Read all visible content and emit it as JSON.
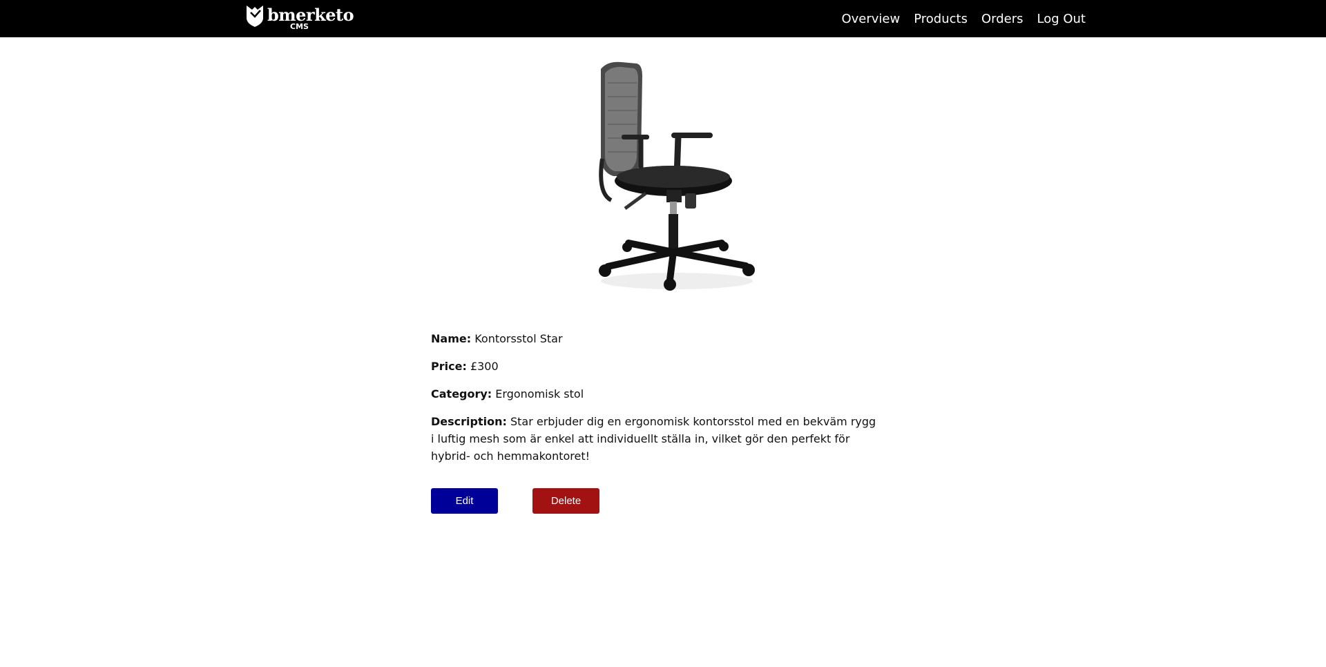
{
  "header": {
    "brand_name": "bmerketo",
    "brand_sub": "CMS",
    "nav": [
      {
        "label": "Overview"
      },
      {
        "label": "Products"
      },
      {
        "label": "Orders"
      },
      {
        "label": "Log Out"
      }
    ]
  },
  "product": {
    "name_label": "Name:",
    "name": "Kontorsstol Star",
    "price_label": "Price:",
    "price": "£300",
    "category_label": "Category:",
    "category": "Ergonomisk stol",
    "description_label": "Description:",
    "description": "Star erbjuder dig en ergonomisk kontorsstol med en bekväm rygg i luftig mesh som är enkel att individuellt ställa in, vilket gör den perfekt för hybrid- och hemmakontoret!"
  },
  "actions": {
    "edit_label": "Edit",
    "delete_label": "Delete"
  },
  "colors": {
    "topbar": "#000000",
    "edit_button": "#000099",
    "delete_button": "#a31212"
  },
  "icons": {
    "brand": "shield-logo-icon",
    "product": "office-chair-image"
  }
}
